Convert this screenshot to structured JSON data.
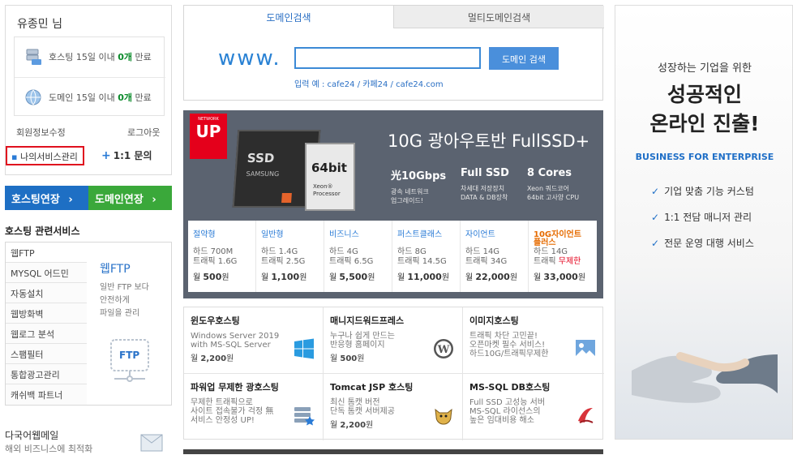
{
  "user": {
    "name": "유종민",
    "suffix": "님"
  },
  "expiry": {
    "hosting": {
      "prefix": "호스팅 15일 이내 ",
      "count": "0개",
      "suffix": " 만료"
    },
    "domain": {
      "prefix": "도메인 15일 이내 ",
      "count": "0개",
      "suffix": " 만료"
    }
  },
  "links": {
    "member_info": "회원정보수정",
    "logout": "로그아웃",
    "my_service": "나의서비스관리",
    "inquiry": "1:1 문의"
  },
  "buttons": {
    "hosting_renew": "호스팅연장",
    "domain_renew": "도메인연장",
    "arrow": "›"
  },
  "hosting_services": {
    "title": "호스팅 관련서비스",
    "items": [
      "웹FTP",
      "MYSQL 어드민",
      "자동설치",
      "웹방화벽",
      "웹로그 분석",
      "스팸필터",
      "통합광고관리",
      "캐쉬백 파트너"
    ],
    "feature_title": "웹FTP",
    "feature_desc": [
      "일반 FTP 보다",
      "안전하게",
      "파일을 관리"
    ],
    "icon_label": "FTP"
  },
  "multilang_mail": {
    "title": "다국어웹메일",
    "desc": "해외 비즈니스에 최적화"
  },
  "domain_search": {
    "tabs": [
      "도메인검색",
      "멀티도메인검색"
    ],
    "prefix": "www.",
    "input_value": "",
    "button": "도메인 검색",
    "example": "입력 예 : cafe24 / 카페24 / cafe24.com"
  },
  "banner": {
    "badge_small": "NETWORK",
    "badge": "UP",
    "ssd_label": "SSD",
    "ssd_brand": "SAMSUNG",
    "chip_title": "64bit",
    "chip_sub": "Xeon® Processor",
    "title": "10G 광아우토반 FullSSD+",
    "features": [
      {
        "head": "光10Gbps",
        "desc": [
          "광속 네트워크",
          "업그레이드!"
        ]
      },
      {
        "head": "Full SSD",
        "desc": [
          "차세대 저장장치",
          "DATA & DB장착"
        ]
      },
      {
        "head": "8 Cores",
        "desc": [
          "Xeon 쿼드코어",
          "64bit 고사양 CPU"
        ]
      }
    ],
    "plans": [
      {
        "name": "절약형",
        "disk": "하드 700M",
        "traffic": "트래픽 1.6G",
        "price_label": "월 ",
        "price": "500",
        "unit": "원"
      },
      {
        "name": "일반형",
        "disk": "하드 1.4G",
        "traffic": "트래픽 2.5G",
        "price_label": "월 ",
        "price": "1,100",
        "unit": "원"
      },
      {
        "name": "비즈니스",
        "disk": "하드 4G",
        "traffic": "트래픽 6.5G",
        "price_label": "월 ",
        "price": "5,500",
        "unit": "원"
      },
      {
        "name": "퍼스트클래스",
        "disk": "하드 8G",
        "traffic": "트래픽 14.5G",
        "price_label": "월 ",
        "price": "11,000",
        "unit": "원"
      },
      {
        "name": "자이언트",
        "disk": "하드 14G",
        "traffic": "트래픽 34G",
        "price_label": "월 ",
        "price": "22,000",
        "unit": "원"
      },
      {
        "name": "10G자이언트",
        "name2": "플러스",
        "disk": "하드 14G",
        "traffic": "트래픽 ",
        "traffic_red": "무제한",
        "price_label": "월 ",
        "price": "33,000",
        "unit": "원"
      }
    ]
  },
  "services": [
    {
      "title": "윈도우호스팅",
      "desc": [
        "Windows Server 2019",
        "with MS-SQL Server"
      ],
      "price_label": "월 ",
      "price": "2,200",
      "unit": "원",
      "icon": "windows-icon"
    },
    {
      "title": "매니지드워드프레스",
      "desc": [
        "누구나 쉽게 만드는",
        "반응형 홈페이지"
      ],
      "price_label": "월 ",
      "price": "500",
      "unit": "원",
      "icon": "wordpress-icon"
    },
    {
      "title": "이미지호스팅",
      "desc": [
        "트래픽 차단 고민끝!",
        "오픈마켓 필수 서비스!",
        "하드10G/트래픽무제한"
      ],
      "icon": "image-icon"
    },
    {
      "title": "파워업 무제한 광호스팅",
      "desc": [
        "무제한 트래픽으로",
        "사이트 접속불가 걱정 無",
        "서비스 안정성 UP!"
      ],
      "icon": "server-icon"
    },
    {
      "title": "Tomcat JSP 호스팅",
      "desc": [
        "최신 톰캣 버전",
        "단독 톰캣 서버제공"
      ],
      "price_label": "월 ",
      "price": "2,200",
      "unit": "원",
      "icon": "tomcat-icon"
    },
    {
      "title": "MS-SQL DB호스팅",
      "desc": [
        "Full SSD 고성능 서버",
        "MS-SQL 라이선스의",
        "높은 임대비용 해소"
      ],
      "icon": "mssql-icon"
    }
  ],
  "ad": {
    "line1": "성장하는 기업을 위한",
    "line2": "성공적인",
    "line3": "온라인 진출!",
    "tagline": "BUSINESS FOR ENTERPRISE",
    "checks": [
      "기업 맞춤 기능 커스텀",
      "1:1 전담 매니저 관리",
      "전문 운영 대행 서비스"
    ]
  },
  "colors": {
    "accent_blue": "#1e6fc4",
    "accent_green": "#3aa83a",
    "highlight_red": "#e0101e",
    "banner_bg": "#5b6370"
  }
}
